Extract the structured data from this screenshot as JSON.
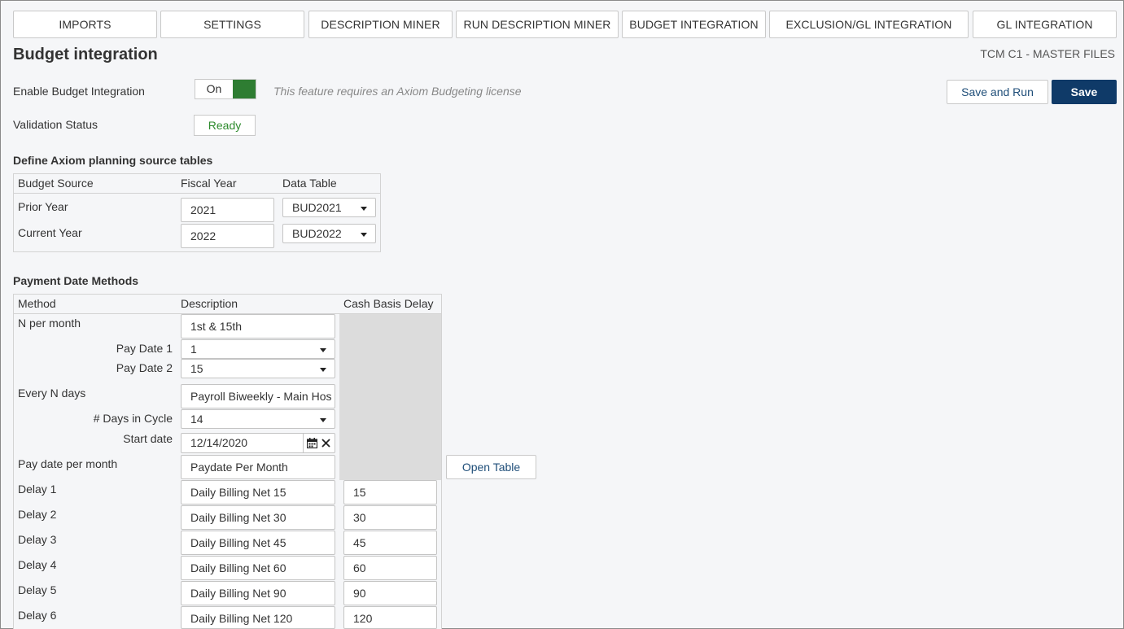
{
  "tabs": [
    {
      "label": "IMPORTS"
    },
    {
      "label": "SETTINGS"
    },
    {
      "label": "DESCRIPTION MINER"
    },
    {
      "label": "RUN DESCRIPTION MINER"
    },
    {
      "label": "BUDGET INTEGRATION"
    },
    {
      "label": "EXCLUSION/GL INTEGRATION"
    },
    {
      "label": "GL INTEGRATION"
    }
  ],
  "header": {
    "title": "Budget integration",
    "context": "TCM C1 - MASTER FILES"
  },
  "enable": {
    "label": "Enable Budget Integration",
    "toggle_state": "On",
    "note": "This feature requires an Axiom Budgeting license"
  },
  "actions": {
    "save_and_run": "Save and Run",
    "save": "Save"
  },
  "validation": {
    "label": "Validation Status",
    "value": "Ready"
  },
  "source_tables": {
    "title": "Define Axiom planning source tables",
    "columns": [
      "Budget Source",
      "Fiscal Year",
      "Data Table"
    ],
    "rows": [
      {
        "source": "Prior Year",
        "year": "2021",
        "table": "BUD2021"
      },
      {
        "source": "Current Year",
        "year": "2022",
        "table": "BUD2022"
      }
    ]
  },
  "payment": {
    "title": "Payment Date Methods",
    "columns": [
      "Method",
      "Description",
      "Cash Basis Delay"
    ],
    "n_per_month": {
      "label": "N per month",
      "description": "1st & 15th",
      "pay_date_1_label": "Pay Date 1",
      "pay_date_1": "1",
      "pay_date_2_label": "Pay Date 2",
      "pay_date_2": "15"
    },
    "every_n_days": {
      "label": "Every N days",
      "description": "Payroll Biweekly - Main Hos",
      "days_label": "# Days in Cycle",
      "days": "14",
      "start_label": "Start date",
      "start": "12/14/2020"
    },
    "pay_date_per_month": {
      "label": "Pay date per month",
      "description": "Paydate Per Month",
      "open_table": "Open Table"
    },
    "delays": [
      {
        "label": "Delay 1",
        "description": "Daily Billing Net 15",
        "value": "15"
      },
      {
        "label": "Delay 2",
        "description": "Daily Billing Net 30",
        "value": "30"
      },
      {
        "label": "Delay 3",
        "description": "Daily Billing Net 45",
        "value": "45"
      },
      {
        "label": "Delay 4",
        "description": "Daily Billing Net 60",
        "value": "60"
      },
      {
        "label": "Delay 5",
        "description": "Daily Billing Net 90",
        "value": "90"
      },
      {
        "label": "Delay 6",
        "description": "Daily Billing Net 120",
        "value": "120"
      }
    ]
  },
  "colors": {
    "primary": "#0f3a68",
    "toggle_on": "#2e7d32",
    "ready": "#2e8b2e"
  }
}
